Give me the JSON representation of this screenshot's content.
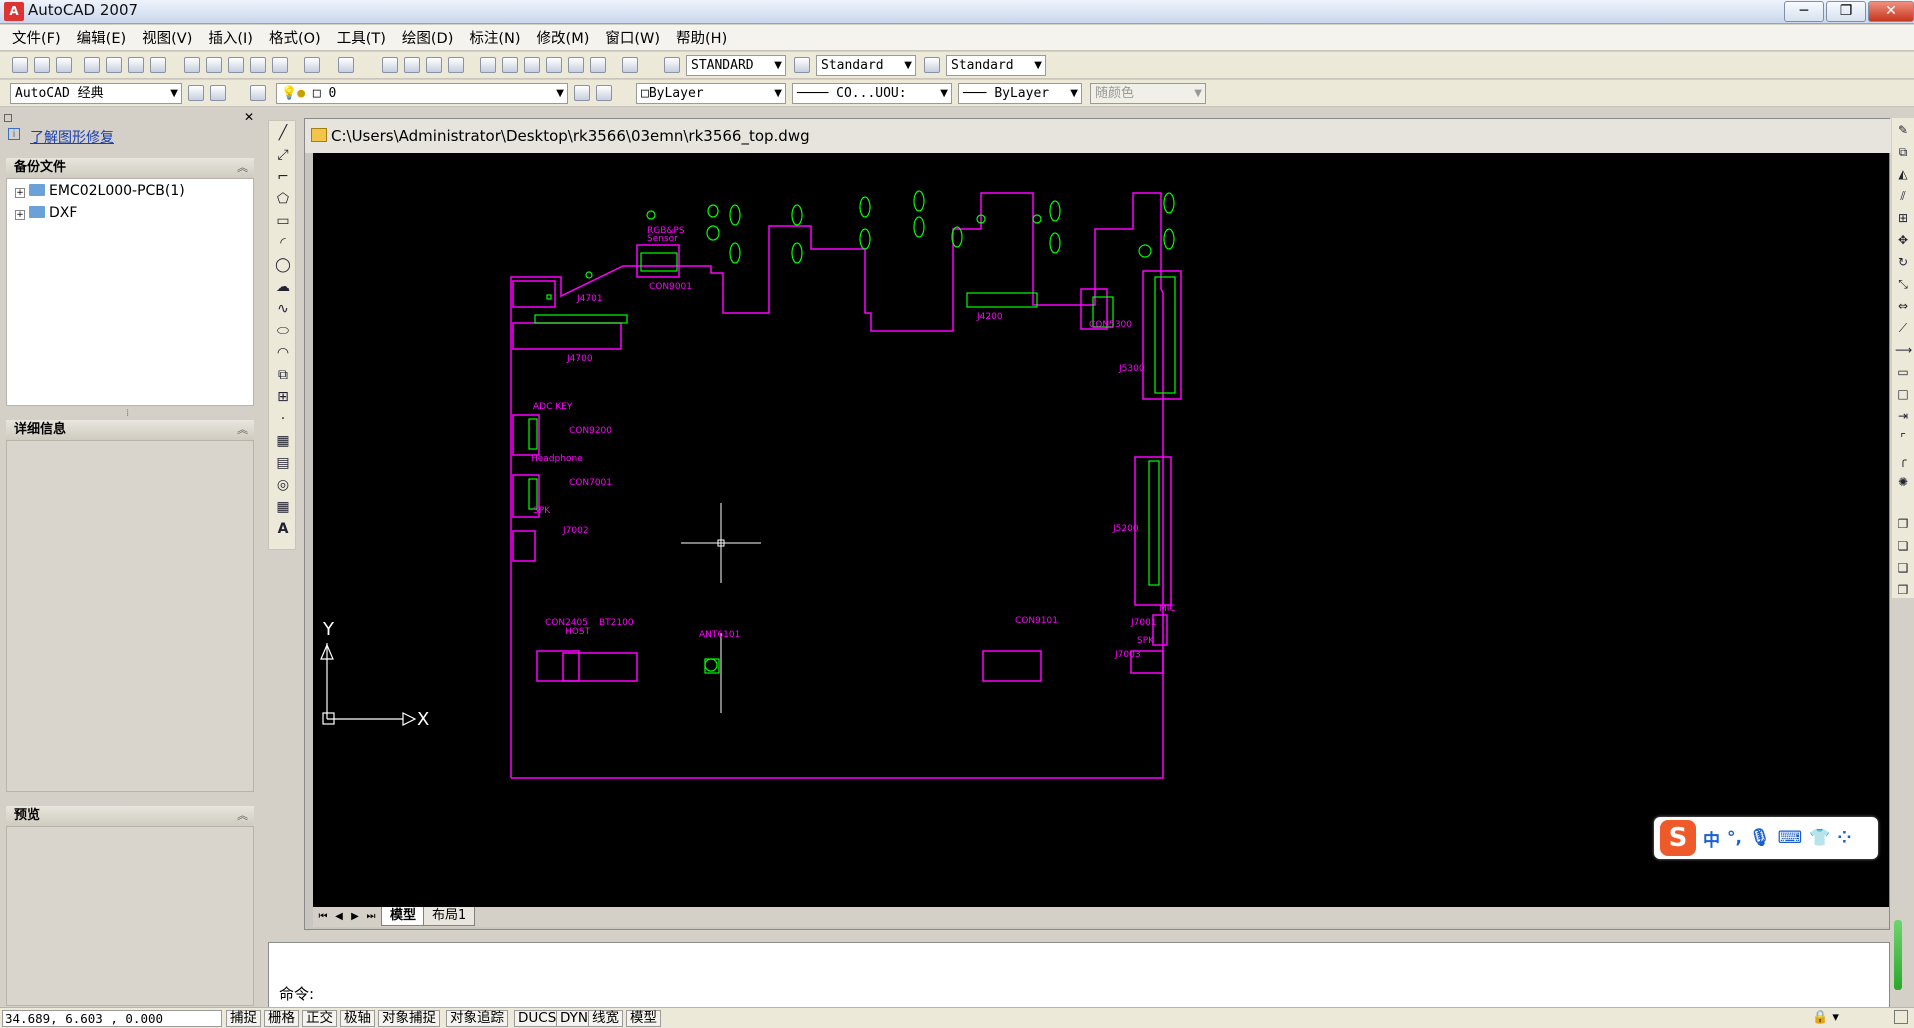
{
  "window": {
    "title": "AutoCAD 2007",
    "minimize": "─",
    "restore": "❐",
    "close": "✕"
  },
  "menu": [
    "文件(F)",
    "编辑(E)",
    "视图(V)",
    "插入(I)",
    "格式(O)",
    "工具(T)",
    "绘图(D)",
    "标注(N)",
    "修改(M)",
    "窗口(W)",
    "帮助(H)"
  ],
  "toolbar": {
    "text_style": "STANDARD",
    "dim_style": "Standard",
    "table_style": "Standard",
    "workspace": "AutoCAD 经典",
    "layer": "0",
    "color": "ByLayer",
    "linetype": "CO...UOU:",
    "lineweight": "ByLayer",
    "plotstyle": "随颜色"
  },
  "left_panel": {
    "link": "了解图形修复",
    "backup_title": "备份文件",
    "backup_items": [
      "EMC02L000-PCB(1)",
      "DXF"
    ],
    "details_title": "详细信息",
    "preview_title": "预览"
  },
  "drawing": {
    "path": "C:\\Users\\Administrator\\Desktop\\rk3566\\03emn\\rk3566_top.dwg",
    "labels": {
      "rgb": "RGB&PS",
      "sensor": "Sensor",
      "con9001": "CON9001",
      "j4701": "J4701",
      "j4700": "J4700",
      "j4200": "J4200",
      "con5300": "CON5300",
      "j5300": "J5300",
      "adc": "ADC KEY",
      "con9200": "CON9200",
      "headphone": "Headphone",
      "con7001": "CON7001",
      "spk": "SPK",
      "j7002": "J7002",
      "j5200": "J5200",
      "con2405": "CON2405",
      "host": "HOST",
      "bt2100": "BT2100",
      "ant6101": "ANT6101",
      "con9101": "CON9101",
      "j7001": "J7001",
      "spk2": "SPK",
      "j7003": "J7003",
      "mic": "MIC"
    },
    "ucs_x": "X",
    "ucs_y": "Y"
  },
  "layout_tabs": [
    "模型",
    "布局1"
  ],
  "command": {
    "prompt": "命令:"
  },
  "status": {
    "coords": "34.689, 6.603 , 0.000",
    "buttons": [
      "捕捉",
      "栅格",
      "正交",
      "极轴",
      "对象捕捉",
      "对象追踪",
      "DUCS",
      "DYN",
      "线宽",
      "模型"
    ]
  },
  "ime": {
    "logo": "S",
    "mode": "中",
    "punct": "°,"
  },
  "colors": {
    "board": "#ff00ff",
    "component": "#00ff00",
    "crosshair": "#ffffff",
    "canvas": "#000000"
  }
}
